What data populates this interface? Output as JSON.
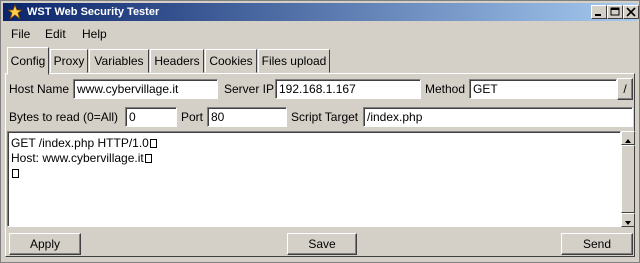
{
  "window": {
    "title": "WST Web Security Tester"
  },
  "menu": {
    "items": [
      "File",
      "Edit",
      "Help"
    ]
  },
  "tabs": [
    "Config",
    "Proxy",
    "Variables",
    "Headers",
    "Cookies",
    "Files upload"
  ],
  "active_tab": "Config",
  "config": {
    "host_name_label": "Host Name",
    "host_name_value": "www.cybervillage.it",
    "server_ip_label": "Server IP",
    "server_ip_value": "192.168.1.167",
    "method_label": "Method",
    "method_value": "GET",
    "method_button_label": "/",
    "bytes_label": "Bytes to read (0=All)",
    "bytes_value": "0",
    "port_label": "Port",
    "port_value": "80",
    "script_label": "Script Target",
    "script_value": "/index.php"
  },
  "request": {
    "lines": [
      "GET /index.php HTTP/1.0",
      "Host: www.cybervillage.it",
      ""
    ]
  },
  "buttons": {
    "apply": "Apply",
    "save": "Save",
    "send": "Send"
  },
  "icons": [
    "app-icon",
    "minimize-icon",
    "maximize-icon",
    "close-icon",
    "scroll-up-icon",
    "scroll-down-icon"
  ]
}
